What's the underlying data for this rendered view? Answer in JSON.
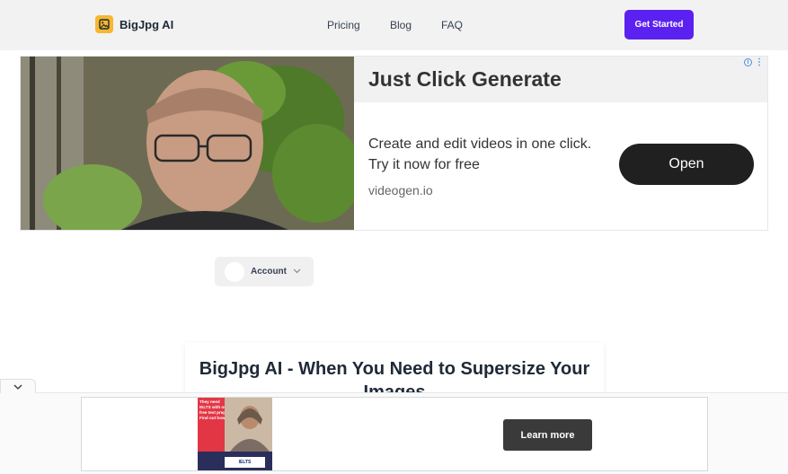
{
  "header": {
    "brand": "BigJpg AI",
    "nav": {
      "pricing": "Pricing",
      "blog": "Blog",
      "faq": "FAQ"
    },
    "cta_label": "Get Started",
    "accent_color": "#5b21f0",
    "logo_color": "#f5b82e"
  },
  "top_ad": {
    "headline": "Just Click Generate",
    "body_line1": "Create and edit videos in one click.",
    "body_line2": "Try it now for free",
    "domain": "videogen.io",
    "button_label": "Open",
    "info_icon": "ⓘ",
    "menu_icon": "⋮"
  },
  "account": {
    "label": "Account",
    "chevron": "⌄"
  },
  "hero": {
    "title": "BigJpg AI - When You Need to Supersize Your Images"
  },
  "bottom_ad": {
    "image_text": "They need IELTS with our free test prep. Find out how!",
    "logo_text": "IELTS",
    "button_label": "Learn more"
  },
  "collapse_tab": {
    "icon": "chevron-down-icon"
  }
}
